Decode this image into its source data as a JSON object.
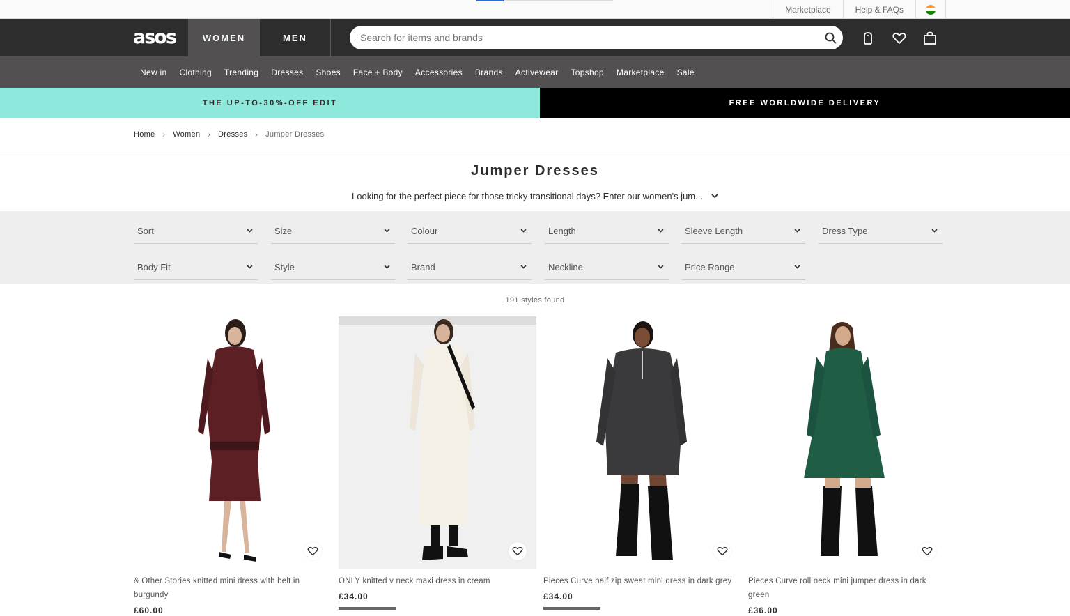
{
  "utility": {
    "marketplace": "Marketplace",
    "help": "Help & FAQs"
  },
  "header": {
    "logo": "asos",
    "women": "WOMEN",
    "men": "MEN",
    "search_placeholder": "Search for items and brands"
  },
  "nav": [
    "New in",
    "Clothing",
    "Trending",
    "Dresses",
    "Shoes",
    "Face + Body",
    "Accessories",
    "Brands",
    "Activewear",
    "Topshop",
    "Marketplace",
    "Sale"
  ],
  "promo": {
    "left": "THE UP-TO-30%-OFF EDIT",
    "right": "FREE WORLDWIDE DELIVERY"
  },
  "breadcrumb": [
    "Home",
    "Women",
    "Dresses",
    "Jumper Dresses"
  ],
  "page": {
    "title": "Jumper Dresses",
    "description": "Looking for the perfect piece for those tricky transitional days? Enter our women's jum..."
  },
  "filters": [
    "Sort",
    "Size",
    "Colour",
    "Length",
    "Sleeve Length",
    "Dress Type",
    "Body Fit",
    "Style",
    "Brand",
    "Neckline",
    "Price Range"
  ],
  "results": {
    "count": "191 styles found"
  },
  "products": [
    {
      "name": "& Other Stories knitted mini dress with belt in burgundy",
      "price": "£60.00",
      "color": "#5c1f24"
    },
    {
      "name": "ONLY knitted v neck maxi dress in cream",
      "price": "£34.00",
      "color": "#efe9df"
    },
    {
      "name": "Pieces Curve half zip sweat mini dress in dark grey",
      "price": "£34.00",
      "color": "#3a3a3c"
    },
    {
      "name": "Pieces Curve roll neck mini jumper dress in dark green",
      "price": "£36.00",
      "color": "#1f5d45"
    }
  ]
}
